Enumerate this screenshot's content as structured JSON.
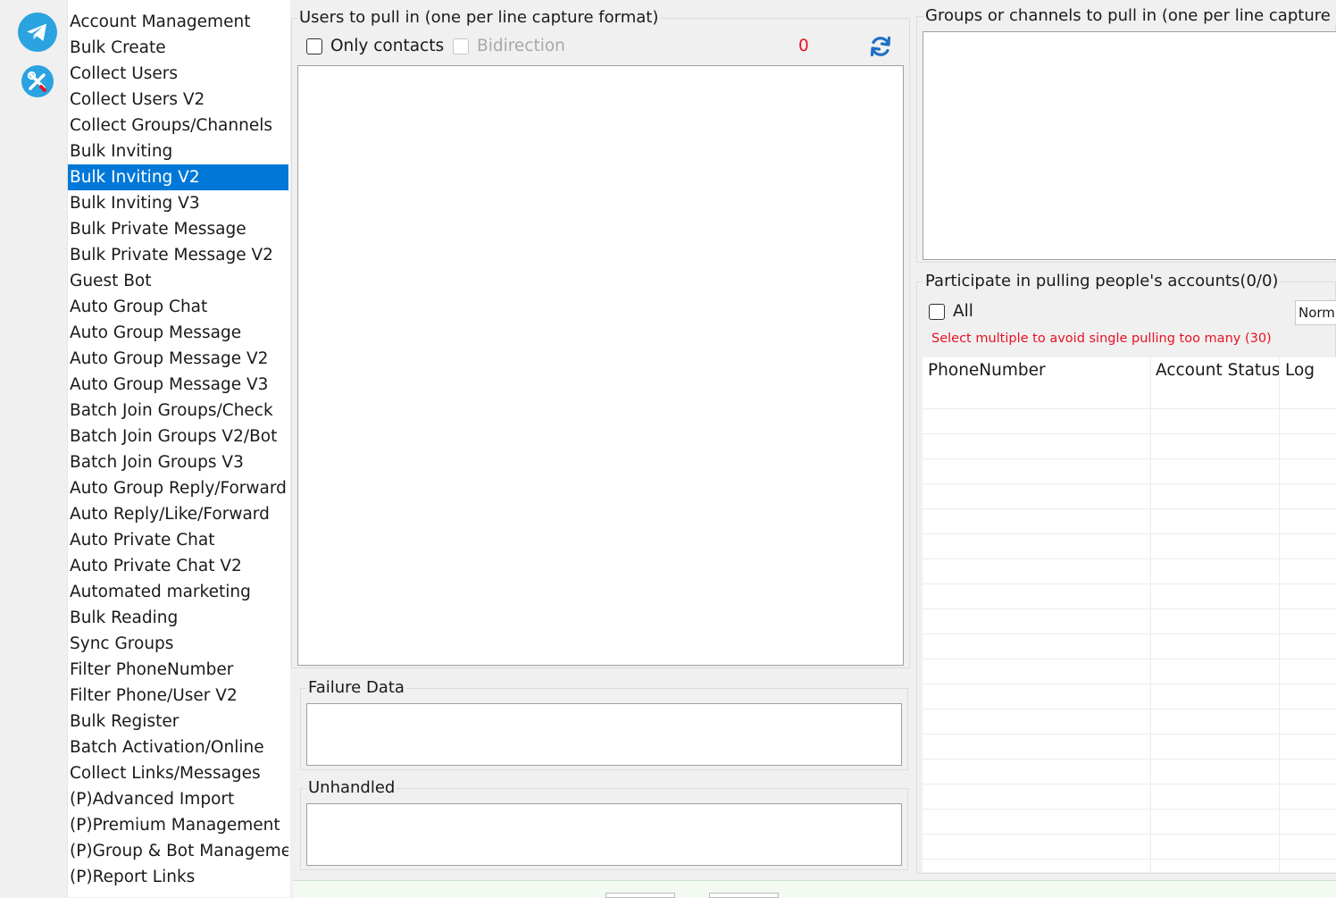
{
  "nav": {
    "items": [
      {
        "label": "Account Management"
      },
      {
        "label": "Bulk Create"
      },
      {
        "label": "Collect Users"
      },
      {
        "label": "Collect Users V2"
      },
      {
        "label": "Collect Groups/Channels"
      },
      {
        "label": "Bulk Inviting"
      },
      {
        "label": "Bulk Inviting V2",
        "selected": true
      },
      {
        "label": "Bulk Inviting V3"
      },
      {
        "label": "Bulk Private Message"
      },
      {
        "label": "Bulk Private Message V2"
      },
      {
        "label": "Guest Bot"
      },
      {
        "label": "Auto Group Chat"
      },
      {
        "label": "Auto Group Message"
      },
      {
        "label": "Auto Group Message V2"
      },
      {
        "label": "Auto Group Message V3"
      },
      {
        "label": "Batch Join Groups/Check"
      },
      {
        "label": "Batch Join Groups V2/Bot"
      },
      {
        "label": "Batch Join Groups V3"
      },
      {
        "label": "Auto Group Reply/Forward"
      },
      {
        "label": "Auto Reply/Like/Forward"
      },
      {
        "label": "Auto Private Chat"
      },
      {
        "label": "Auto Private Chat V2"
      },
      {
        "label": "Automated marketing"
      },
      {
        "label": "Bulk Reading"
      },
      {
        "label": "Sync Groups"
      },
      {
        "label": "Filter PhoneNumber"
      },
      {
        "label": "Filter Phone/User V2"
      },
      {
        "label": "Bulk Register"
      },
      {
        "label": "Batch Activation/Online"
      },
      {
        "label": "Collect Links/Messages"
      },
      {
        "label": "(P)Advanced Import"
      },
      {
        "label": "(P)Premium Management"
      },
      {
        "label": "(P)Group & Bot Managemer"
      },
      {
        "label": "(P)Report Links"
      }
    ]
  },
  "users_panel": {
    "title": "Users to pull in (one per line capture format)",
    "only_contacts_label": "Only contacts",
    "bidirection_label": "Bidirection",
    "count": "0"
  },
  "failure": {
    "title": "Failure Data"
  },
  "unhandled": {
    "title": "Unhandled"
  },
  "groups_panel": {
    "title": "Groups or channels to pull in (one per line capture for"
  },
  "accounts_panel": {
    "title": "Participate in pulling people's accounts(0/0)",
    "all_label": "All",
    "mode_value": "Norm",
    "hint": "Select multiple to avoid single pulling too many (30)",
    "columns": [
      "PhoneNumber",
      "Account Status",
      "Log"
    ]
  },
  "colors": {
    "accent": "#0078d7",
    "telegram": "#2aa3e0",
    "warning": "#e81123"
  }
}
